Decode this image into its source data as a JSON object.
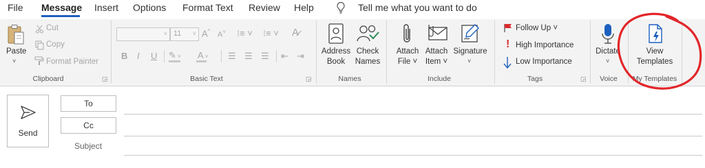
{
  "menu": {
    "tabs": [
      "File",
      "Message",
      "Insert",
      "Options",
      "Format Text",
      "Review",
      "Help"
    ],
    "active_tab": "Message",
    "tell_me": "Tell me what you want to do"
  },
  "ribbon": {
    "clipboard": {
      "paste": "Paste",
      "cut": "Cut",
      "copy": "Copy",
      "format_painter": "Format Painter",
      "label": "Clipboard"
    },
    "basic_text": {
      "font_size": "11",
      "label": "Basic Text"
    },
    "names": {
      "address_book": [
        "Address",
        "Book"
      ],
      "check_names": [
        "Check",
        "Names"
      ],
      "label": "Names"
    },
    "include": {
      "attach_file": [
        "Attach",
        "File ˅"
      ],
      "attach_item": [
        "Attach",
        "Item ˅"
      ],
      "signature": "Signature",
      "label": "Include"
    },
    "tags": {
      "follow_up": "Follow Up ˅",
      "high_importance": "High Importance",
      "low_importance": "Low Importance",
      "label": "Tags"
    },
    "voice": {
      "dictate": "Dictate",
      "label": "Voice"
    },
    "my_templates": {
      "view_templates": [
        "View",
        "Templates"
      ],
      "label": "My Templates"
    }
  },
  "compose": {
    "send": "Send",
    "to": "To",
    "cc": "Cc",
    "subject": "Subject"
  },
  "colors": {
    "accent": "#1e5fbf",
    "annotation": "#e2262a",
    "flag": "#d92b2b"
  }
}
